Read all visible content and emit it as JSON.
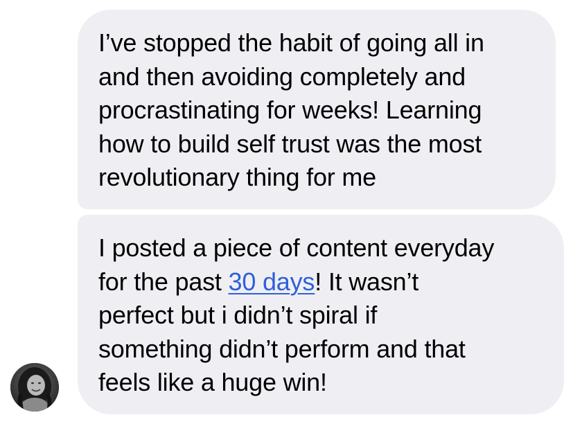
{
  "messages": [
    {
      "id": "msg-1",
      "lines": [
        "I’ve stopped the habit of going all in",
        "and then avoiding completely and",
        "procrastinating for weeks! Learning",
        "how to build self trust was the most",
        "revolutionary thing for me"
      ]
    },
    {
      "id": "msg-2",
      "line1": "I posted a piece of content everyday",
      "line2_before": "for the past ",
      "line2_link": "30 days",
      "line2_after": "! It wasn’t",
      "line3": "perfect but i didn’t spiral if",
      "line4": "something didn’t perform and that",
      "line5": "feels like a huge win!"
    }
  ],
  "colors": {
    "bubble_background": "#efeff3",
    "text": "#000000",
    "link": "#2f5fd9"
  },
  "icons": {
    "avatar": "sender-avatar"
  }
}
